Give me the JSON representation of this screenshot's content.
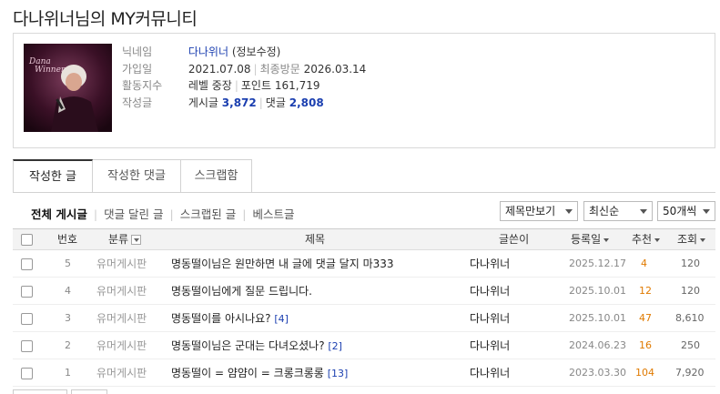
{
  "page": {
    "title": "다나위너님의 MY커뮤니티"
  },
  "profile": {
    "labels": {
      "nickname": "닉네임",
      "joined": "가입일",
      "activity": "활동지수",
      "posts": "작성글"
    },
    "nickname": "다나위너",
    "edit_link": "(정보수정)",
    "joined": "2021.07.08",
    "last_visit_label": "최종방문",
    "last_visit": "2026.03.14",
    "level_label": "레벨",
    "level": "중장",
    "points_label": "포인트",
    "points": "161,719",
    "post_count_label": "게시글",
    "post_count": "3,872",
    "comment_count_label": "댓글",
    "comment_count": "2,808"
  },
  "tabs": [
    "작성한 글",
    "작성한 댓글",
    "스크랩함"
  ],
  "filters": [
    "전체 게시글",
    "댓글 달린 글",
    "스크랩된 글",
    "베스트글"
  ],
  "selects": {
    "view": "제목만보기",
    "order": "최신순",
    "per_page": "50개씩"
  },
  "table": {
    "headers": {
      "num": "번호",
      "category": "분류",
      "title": "제목",
      "author": "글쓴이",
      "date": "등록일",
      "likes": "추천",
      "views": "조회"
    },
    "rows": [
      {
        "num": "5",
        "category": "유머게시판",
        "title": "명동떨이님은 원만하면 내 글에 댓글 달지 마333",
        "comments": "",
        "author": "다나위너",
        "date": "2025.12.17",
        "likes": "4",
        "views": "120"
      },
      {
        "num": "4",
        "category": "유머게시판",
        "title": "명동떨이님에게 질문 드립니다.",
        "comments": "",
        "author": "다나위너",
        "date": "2025.10.01",
        "likes": "12",
        "views": "120"
      },
      {
        "num": "3",
        "category": "유머게시판",
        "title": "명동떨이를 아시나요?",
        "comments": "[4]",
        "author": "다나위너",
        "date": "2025.10.01",
        "likes": "47",
        "views": "8,610"
      },
      {
        "num": "2",
        "category": "유머게시판",
        "title": "명동떨이님은 군대는 다녀오셨나?",
        "comments": "[2]",
        "author": "다나위너",
        "date": "2024.06.23",
        "likes": "16",
        "views": "250"
      },
      {
        "num": "1",
        "category": "유머게시판",
        "title": "명동떨이 = 얌얌이 = 크롱크롱롱",
        "comments": "[13]",
        "author": "다나위너",
        "date": "2023.03.30",
        "likes": "104",
        "views": "7,920"
      }
    ]
  },
  "colors": {
    "accent_blue": "#1b3fb0",
    "likes_orange": "#e07a00"
  },
  "avatar_text": "Dana Winner"
}
